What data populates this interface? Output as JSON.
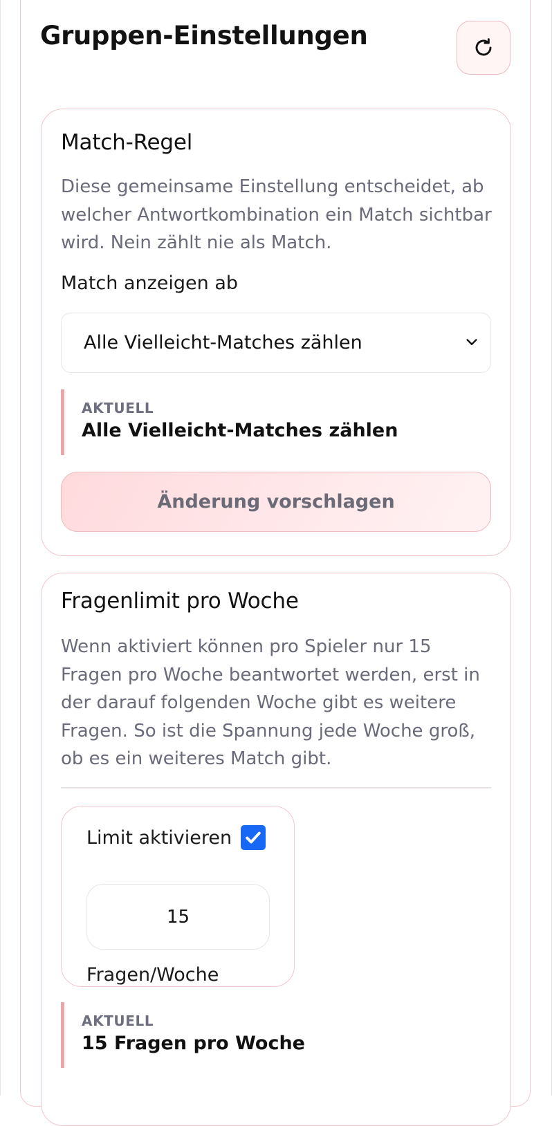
{
  "header": {
    "title": "Gruppen-Einstellungen",
    "refresh_icon": "refresh-icon"
  },
  "match_rule": {
    "title": "Match-Regel",
    "description": "Diese gemeinsame Einstellung entscheidet, ab welcher Antwortkombination ein Match sichtbar wird. Nein zählt nie als Match.",
    "field_label": "Match anzeigen ab",
    "selected_option": "Alle Vielleicht-Matches zählen",
    "current_label": "AKTUELL",
    "current_value": "Alle Vielleicht-Matches zählen",
    "suggest_button": "Änderung vorschlagen"
  },
  "question_limit": {
    "title": "Fragenlimit pro Woche",
    "description": "Wenn aktiviert können pro Spieler nur 15 Fragen pro Woche beantwortet werden, erst in der darauf folgenden Woche gibt es weitere Fragen. So ist die Spannung jede Woche groß, ob es ein weiteres Match gibt.",
    "toggle_label": "Limit aktivieren",
    "enabled": true,
    "value": "15",
    "unit_label": "Fragen/Woche",
    "current_label": "AKTUELL",
    "current_value": "15 Fragen pro Woche"
  },
  "colors": {
    "accent_border": "#f2c6cb",
    "accent_bar": "#eaa4aa",
    "checkbox": "#1668f5",
    "muted_text": "#696a7a"
  }
}
